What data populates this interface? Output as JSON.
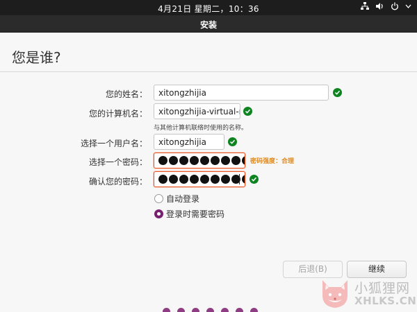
{
  "top_panel": {
    "clock": "4月21日 星期二，10：36",
    "tray_icons": [
      "network-icon",
      "volume-icon",
      "power-icon",
      "chevron-down-icon"
    ]
  },
  "window": {
    "title": "安装"
  },
  "page": {
    "heading": "您是谁?"
  },
  "form": {
    "name": {
      "label": "您的姓名：",
      "value": "xitongzhijia"
    },
    "computer": {
      "label": "您的计算机名：",
      "value": "xitongzhijia-virtual-ma",
      "hint": "与其他计算机联络时使用的名称。"
    },
    "username": {
      "label": "选择一个用户名：",
      "value": "xitongzhijia"
    },
    "password": {
      "label": "选择一个密码：",
      "masked_length": 10,
      "strength": "密码强度：合理"
    },
    "confirm": {
      "label": "确认您的密码：",
      "masked_length": 10
    }
  },
  "login_options": {
    "auto_login": "自动登录",
    "require_password": "登录时需要密码",
    "selected": "require_password"
  },
  "buttons": {
    "back": "后退(B)",
    "continue": "继续"
  },
  "progress": {
    "dots": 7
  },
  "watermark": {
    "line1": "小狐狸网",
    "line2": "XHLKS.CN"
  },
  "colors": {
    "accent_orange": "#e95420",
    "success_green": "#0e8420",
    "ubuntu_purple": "#77216f",
    "progress_dot": "#8e3d83"
  }
}
